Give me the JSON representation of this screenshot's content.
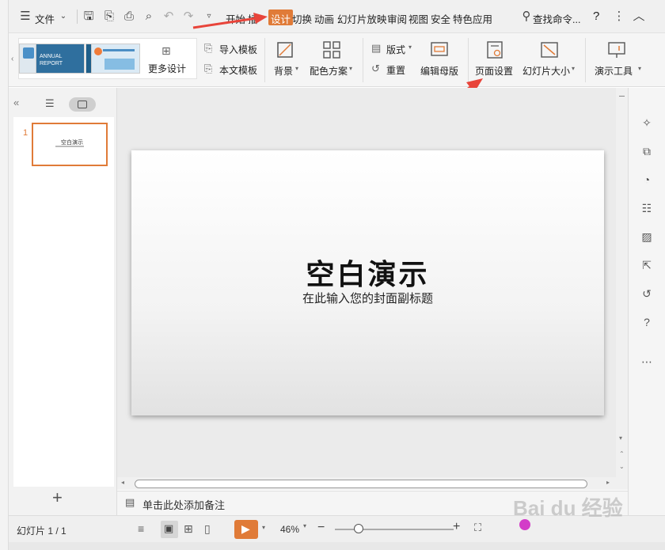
{
  "menu": {
    "file": "文件",
    "tabs": [
      "开始",
      "插",
      "设计",
      "切换",
      "动画",
      "幻灯片放映",
      "审阅",
      "视图",
      "安全",
      "特色应用"
    ],
    "search": "查找命令...",
    "help": "?"
  },
  "ribbon": {
    "thumb1_line1": "ANNUAL",
    "thumb1_line2": "REPORT",
    "more_design": "更多设计",
    "import_template": "导入模板",
    "this_template": "本文模板",
    "background": "背景",
    "color_scheme": "配色方案",
    "layout": "版式",
    "reset": "重置",
    "edit_master": "编辑母版",
    "page_setup": "页面设置",
    "slide_size": "幻灯片大小",
    "presentation_tools": "演示工具"
  },
  "slide_pane": {
    "slide_number": "1",
    "thumb_title": "空白演示",
    "add": "+"
  },
  "slide": {
    "title": "空白演示",
    "subtitle": "在此输入您的封面副标题"
  },
  "notes": {
    "placeholder": "单击此处添加备注"
  },
  "status": {
    "slide_count": "幻灯片 1 / 1",
    "zoom": "46%",
    "watermark": "Bai du 经验"
  },
  "colors": {
    "accent": "#e07b38",
    "arrow": "#e8443a"
  }
}
